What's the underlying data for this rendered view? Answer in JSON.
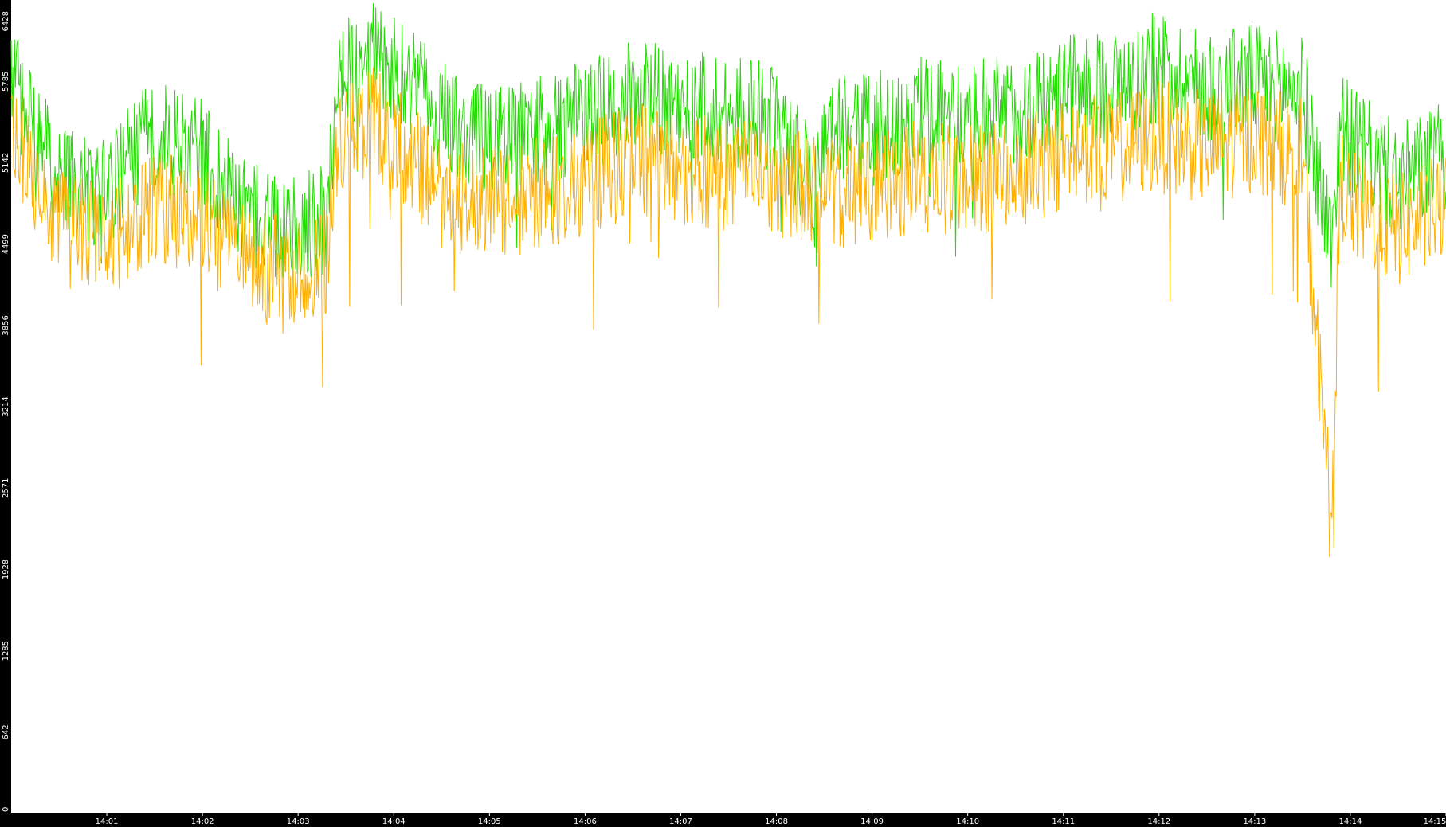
{
  "chart_data": {
    "type": "line",
    "title": "",
    "xlabel": "",
    "ylabel": "",
    "ylim": [
      0,
      6428
    ],
    "yticks": [
      "0",
      "642",
      "1285",
      "1928",
      "2571",
      "3214",
      "3856",
      "4499",
      "5142",
      "5785",
      "6428"
    ],
    "xticks": [
      "14:01",
      "14:02",
      "14:03",
      "14:04",
      "14:05",
      "14:06",
      "14:07",
      "14:08",
      "14:09",
      "14:10",
      "14:11",
      "14:12",
      "14:13",
      "14:14",
      "14:15"
    ],
    "xtick_positions_min": [
      1,
      2,
      3,
      4,
      5,
      6,
      7,
      8,
      9,
      10,
      11,
      12,
      13,
      14,
      15
    ],
    "xlim_min": [
      0,
      15
    ],
    "grid": false,
    "colors": {
      "background": "#000000",
      "plot": "#ffffff",
      "series_green": "#22dd00",
      "series_orange": "#ffb000",
      "text": "#ffffff"
    },
    "series": [
      {
        "color": "#22dd00",
        "x_min": [
          0,
          0.5,
          1,
          1.5,
          2,
          2.5,
          3,
          3.3,
          3.4,
          3.8,
          4,
          4.5,
          5,
          5.5,
          6,
          6.5,
          7,
          7.5,
          8,
          8.4,
          8.5,
          9,
          9.5,
          10,
          10.5,
          11,
          11.5,
          12,
          12.5,
          13,
          13.5,
          13.8,
          13.9,
          14,
          14.5,
          15
        ],
        "values": [
          5800,
          5000,
          4900,
          5400,
          5200,
          4700,
          4600,
          4700,
          5800,
          6000,
          5900,
          5500,
          5300,
          5400,
          5500,
          5700,
          5600,
          5550,
          5500,
          4900,
          5400,
          5400,
          5550,
          5500,
          5550,
          5700,
          5750,
          5900,
          5750,
          5800,
          5700,
          4500,
          5500,
          5300,
          5000,
          5200
        ]
      },
      {
        "color": "#ffb000",
        "x_min": [
          0,
          0.5,
          1,
          1.5,
          2,
          2.5,
          3,
          3.3,
          3.4,
          3.8,
          4,
          4.5,
          5,
          5.5,
          6,
          6.5,
          7,
          7.5,
          8,
          8.5,
          9,
          9.5,
          10,
          10.5,
          11,
          11.5,
          12,
          12.5,
          13,
          13.5,
          13.8,
          13.9,
          14,
          14.5,
          15
        ],
        "values": [
          5400,
          4700,
          4500,
          4800,
          4700,
          4300,
          4300,
          4400,
          5300,
          5500,
          5300,
          4900,
          4800,
          4900,
          5000,
          5200,
          5100,
          5050,
          5000,
          4900,
          4950,
          5050,
          5000,
          5050,
          5200,
          5250,
          5350,
          5250,
          5350,
          5200,
          2300,
          5000,
          4800,
          4600,
          4800
        ]
      }
    ]
  }
}
